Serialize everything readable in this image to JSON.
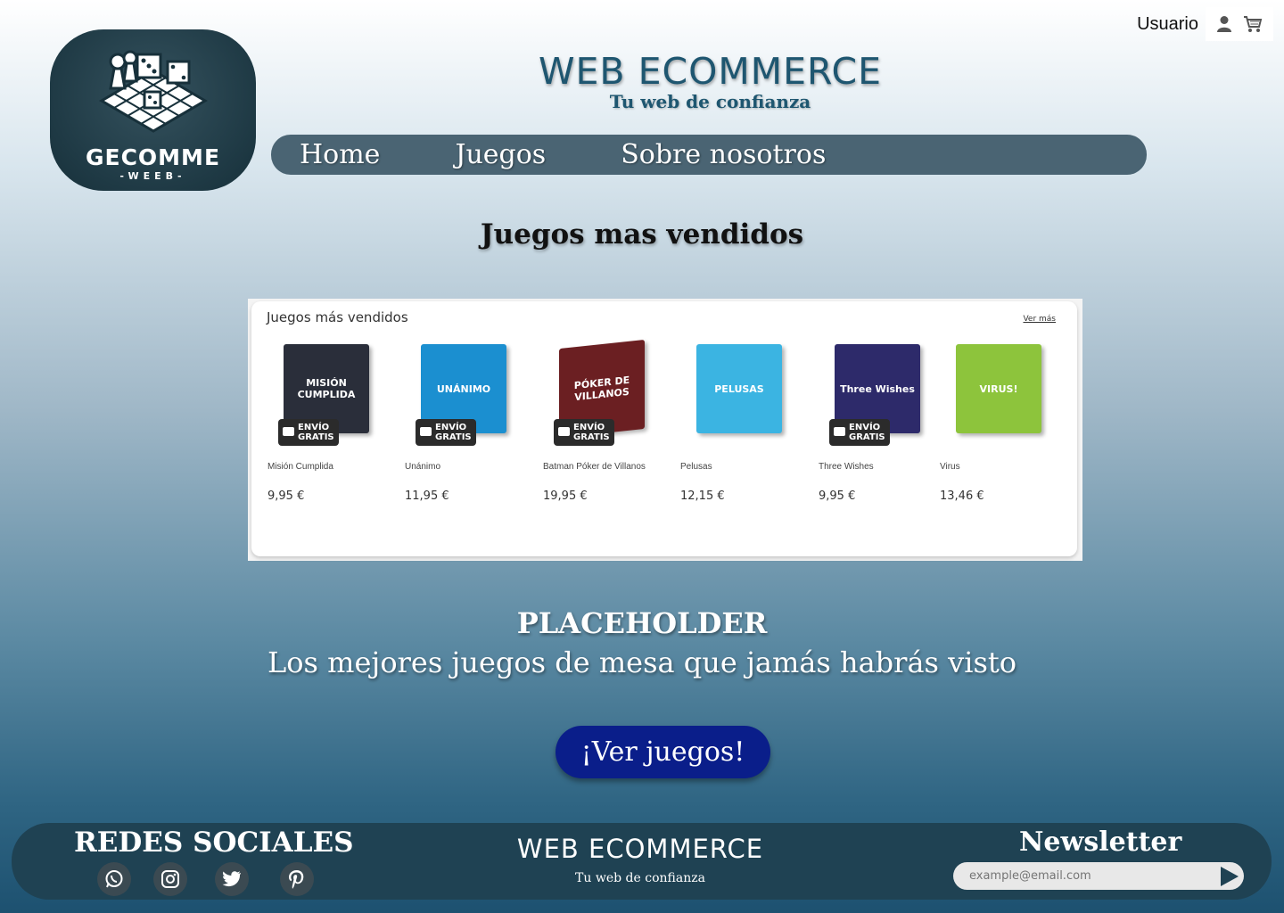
{
  "topbar": {
    "user_label": "Usuario",
    "user_icon": "user-icon",
    "cart_icon": "cart-icon"
  },
  "logo": {
    "brand": "GECOMME",
    "brand_sub": "-WEEB-"
  },
  "header": {
    "title": "WEB ECOMMERCE",
    "tagline": "Tu web de confianza"
  },
  "nav": {
    "items": [
      {
        "label": "Home"
      },
      {
        "label": "Juegos"
      },
      {
        "label": "Sobre nosotros"
      }
    ]
  },
  "bestsellers": {
    "heading": "Juegos mas vendidos",
    "panel_title": "Juegos más vendidos",
    "more_label": "Ver más",
    "badge_line1": "ENVÍO",
    "badge_line2": "GRATIS",
    "products": [
      {
        "name": "Misión Cumplida",
        "price": "9,95 €",
        "cover_title": "MISIÓN CUMPLIDA",
        "color": "#2a2e3a",
        "free_shipping": true
      },
      {
        "name": "Unánimo",
        "price": "11,95 €",
        "cover_title": "UNÁNIMO",
        "color": "#1b8fd0",
        "free_shipping": true
      },
      {
        "name": "Batman Póker de Villanos",
        "price": "19,95 €",
        "cover_title": "PÓKER DE VILLANOS",
        "color": "#6b1f22",
        "free_shipping": true
      },
      {
        "name": "Pelusas",
        "price": "12,15 €",
        "cover_title": "PELUSAS",
        "color": "#3bb4e2",
        "free_shipping": false
      },
      {
        "name": "Three Wishes",
        "price": "9,95 €",
        "cover_title": "Three Wishes",
        "color": "#2d2a6a",
        "free_shipping": true
      },
      {
        "name": "Virus",
        "price": "13,46 €",
        "cover_title": "VIRUS!",
        "color": "#8dc43c",
        "free_shipping": false
      }
    ]
  },
  "promo": {
    "title": "PLACEHOLDER",
    "subtitle": "Los mejores juegos de mesa que jamás habrás visto",
    "cta_label": "¡Ver juegos!"
  },
  "footer": {
    "social_title": "REDES SOCIALES",
    "social_icons": [
      "whatsapp-icon",
      "instagram-icon",
      "twitter-icon",
      "pinterest-icon"
    ],
    "title": "WEB ECOMMERCE",
    "tagline": "Tu web de confianza",
    "newsletter_title": "Newsletter",
    "newsletter_placeholder": "example@email.com"
  },
  "colors": {
    "nav_bg": "#4a6473",
    "cta_bg": "#0a1e8a",
    "footer_bg": "#1f4253",
    "title_color": "#1e5670"
  }
}
